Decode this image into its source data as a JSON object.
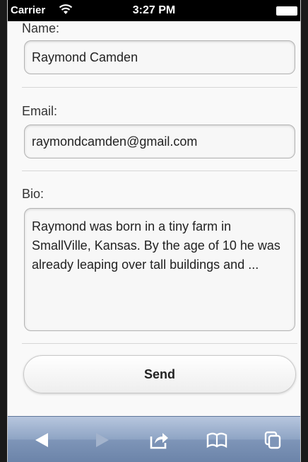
{
  "statusbar": {
    "carrier": "Carrier",
    "time": "3:27 PM"
  },
  "form": {
    "name_label": "Name:",
    "name_value": "Raymond Camden",
    "email_label": "Email:",
    "email_value": "raymondcamden@gmail.com",
    "bio_label": "Bio:",
    "bio_value": "Raymond was born in a tiny farm in SmallVille, Kansas. By the age of 10 he was already leaping over tall buildings and ...",
    "send_label": "Send"
  },
  "toolbar": {
    "icons": [
      "back-icon",
      "forward-icon",
      "share-icon",
      "bookmarks-icon",
      "tabs-icon"
    ]
  },
  "colors": {
    "toolbar": "#7e95b8",
    "page_background": "#f9f9f9"
  }
}
